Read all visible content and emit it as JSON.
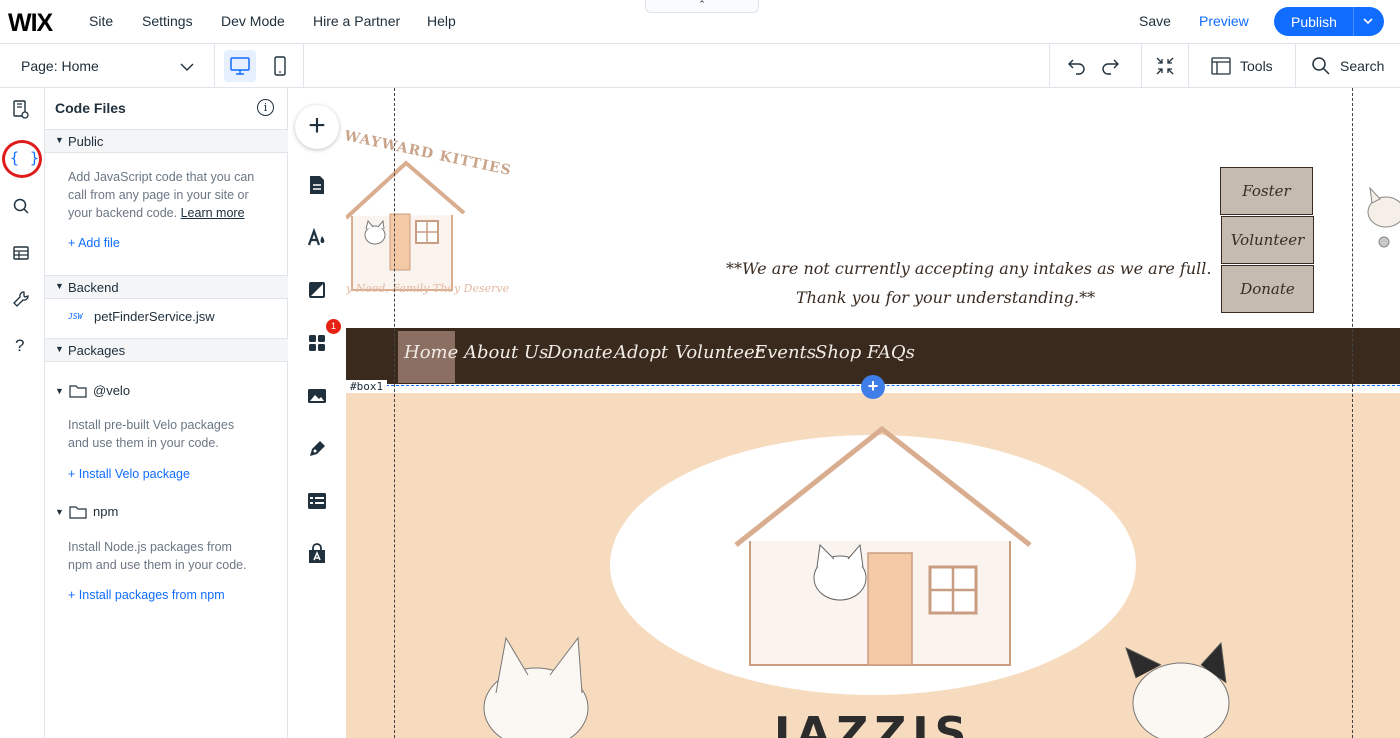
{
  "topbar": {
    "logo": "WIX",
    "menu": [
      "Site",
      "Settings",
      "Dev Mode",
      "Hire a Partner",
      "Help"
    ],
    "save": "Save",
    "preview": "Preview",
    "publish": "Publish"
  },
  "secondbar": {
    "page_label": "Page:",
    "page_name": "Home",
    "tools": "Tools",
    "search": "Search"
  },
  "rail": {
    "code_icon_text": "{ }",
    "help_glyph": "?"
  },
  "panel": {
    "title": "Code Files",
    "public": {
      "header": "Public",
      "desc_lines": [
        "Add JavaScript code that you can",
        "call from any page in your site or",
        "your backend code."
      ],
      "learn_more": "Learn more",
      "add_file": "+ Add file"
    },
    "backend": {
      "header": "Backend",
      "file_badge": "JSW",
      "file_name": "petFinderService.jsw"
    },
    "packages": {
      "header": "Packages",
      "velo": {
        "name": "@velo",
        "desc_lines": [
          "Install pre-built Velo packages",
          "and use them in your code."
        ],
        "link": "+ Install Velo package"
      },
      "npm": {
        "name": "npm",
        "desc_lines": [
          "Install Node.js packages from",
          "npm and use them in your code."
        ],
        "link": "+ Install packages from npm"
      }
    }
  },
  "addcol": {
    "add_glyph": "+",
    "apps_badge": "1"
  },
  "canvas": {
    "logo_text": "WAYWARD KITTIES",
    "logo_tagline": "y Need, Family They Deserve",
    "notice_line1": "**We are not currently accepting any intakes as we are full.",
    "notice_line2": "Thank you for your understanding.**",
    "side_buttons": [
      "Foster",
      "Volunteer",
      "Donate"
    ],
    "nav": [
      "Home",
      "About Us",
      "Donate",
      "Adopt",
      "Volunteer",
      "Events",
      "Shop",
      "FAQs"
    ],
    "box_tag": "#box1",
    "box_plus": "+",
    "hero_title": "JAZZIS"
  },
  "colors": {
    "accent": "#116dff",
    "nav_bg": "#3a2a1e",
    "hero_bg": "#f7dbbe",
    "highlight_circle": "#e01b1b"
  }
}
